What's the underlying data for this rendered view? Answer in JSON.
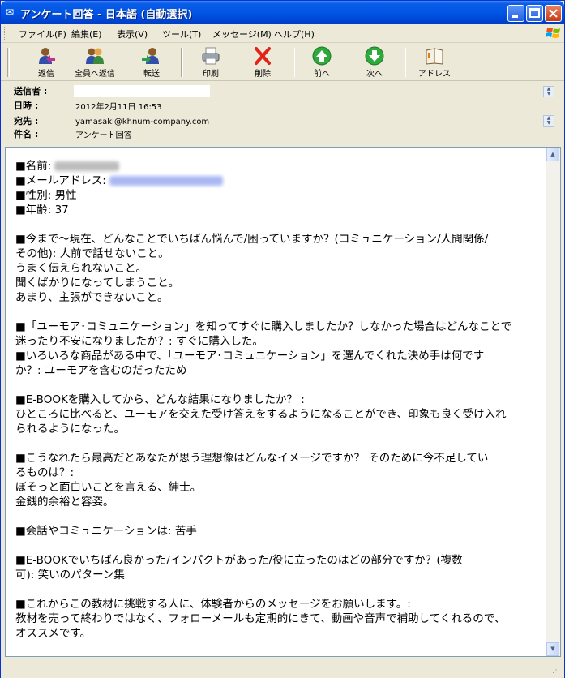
{
  "window": {
    "title": "アンケート回答 - 日本語 (自動選択)"
  },
  "menu": [
    "ファイル(F)",
    "編集(E)",
    "表示(V)",
    "ツール(T)",
    "メッセージ(M)",
    "ヘルプ(H)"
  ],
  "toolbar": {
    "reply": "返信",
    "reply_all": "全員へ返信",
    "forward": "転送",
    "print": "印刷",
    "delete": "削除",
    "previous": "前へ",
    "next": "次へ",
    "address": "アドレス"
  },
  "header": {
    "from_label": "送信者 :",
    "date_label": "日時 :",
    "date_value": "2012年2月11日 16:53",
    "to_label": "宛先 :",
    "to_value": "yamasaki@khnum-company.com",
    "subject_label": "件名 :",
    "subject_value": "アンケート回答"
  },
  "body": {
    "name_label": "■名前:",
    "email_label": "■メールアドレス:",
    "gender": "■性別: 男性",
    "age": "■年齢: 37",
    "q1_l1": "■今まで〜現在、どんなことでいちばん悩んで/困っていますか？(コミュニケーション/人間関係/",
    "q1_l2": "その他): 人前で話せないこと。",
    "q1_l3": "うまく伝えられないこと。",
    "q1_l4": "聞くばかりになってしまうこと。",
    "q1_l5": "あまり、主張ができないこと。",
    "q2_l1": "■「ユーモア･コミュニケーション」を知ってすぐに購入しましたか？しなかった場合はどんなことで",
    "q2_l2": "迷ったり不安になりましたか？: すぐに購入した。",
    "q3_l1": "■いろいろな商品がある中で、「ユーモア･コミュニケーション」を選んでくれた決め手は何です",
    "q3_l2": "か？: ユーモアを含むのだったため",
    "q4_l1": "■E-BOOKを購入してから、どんな結果になりましたか？ :",
    "q4_l2": "ひところに比べると、ユーモアを交えた受け答えをするようになることができ、印象も良く受け入れ",
    "q4_l3": "られるようになった。",
    "q5_l1": "■こうなれたら最高だとあなたが思う理想像はどんなイメージですか？ そのために今不足してい",
    "q5_l2": "るものは？:",
    "q5_l3": "ぼそっと面白いことを言える、紳士。",
    "q5_l4": "金銭的余裕と容姿。",
    "q6_l1": "■会話やコミュニケーションは: 苦手",
    "q7_l1": "■E-BOOKでいちばん良かった/インパクトがあった/役に立ったのはどの部分ですか？(複数",
    "q7_l2": "可): 笑いのパターン集",
    "q8_l1": "■これからこの教材に挑戦する人に、体験者からのメッセージをお願いします。:",
    "q8_l2": "教材を売って終わりではなく、フォローメールも定期的にきて、動画や音声で補助してくれるので、",
    "q8_l3": "オススメです。"
  }
}
